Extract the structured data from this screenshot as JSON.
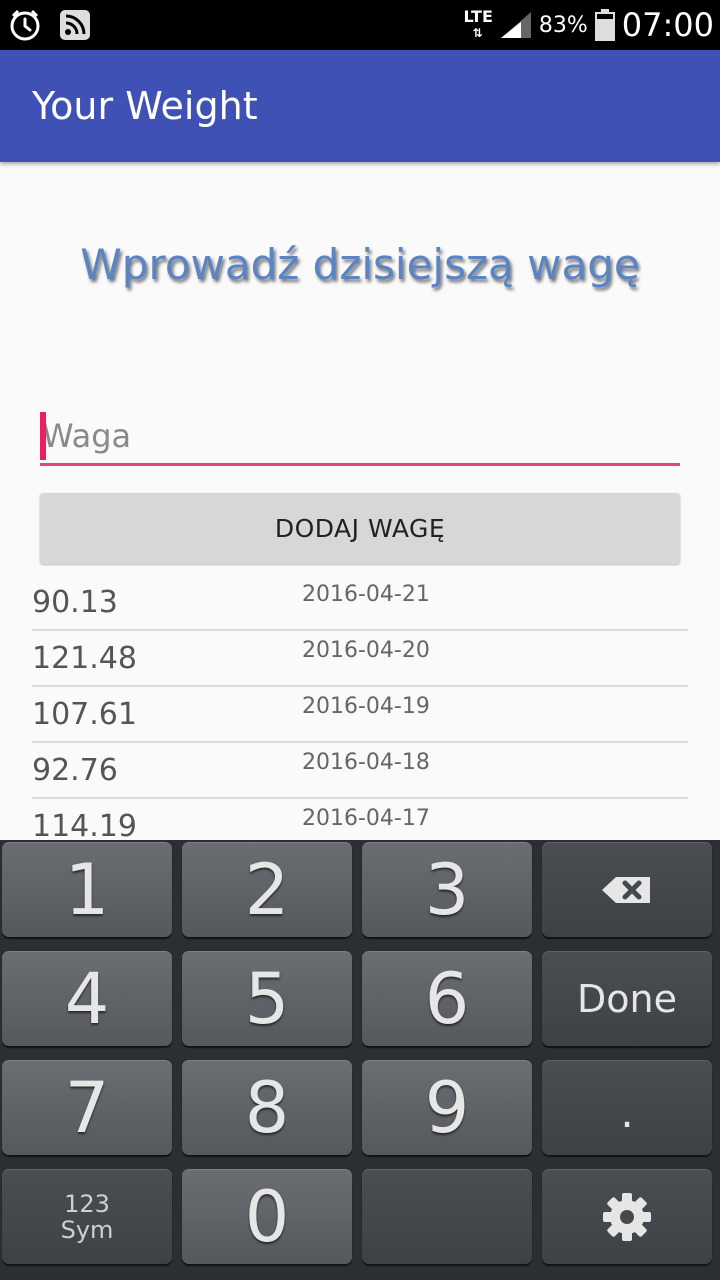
{
  "status_bar": {
    "network": "LTE",
    "battery": "83%",
    "time": "07:00",
    "icons": [
      "alarm-icon",
      "rss-icon",
      "signal-icon",
      "battery-icon"
    ]
  },
  "app_bar": {
    "title": "Your Weight"
  },
  "main": {
    "heading": "Wprowadź dzisiejszą wagę",
    "weight_input": {
      "placeholder": "Waga",
      "value": ""
    },
    "add_button_label": "DODAJ WAGĘ",
    "entries": [
      {
        "weight": "90.13",
        "date": "2016-04-21"
      },
      {
        "weight": "121.48",
        "date": "2016-04-20"
      },
      {
        "weight": "107.61",
        "date": "2016-04-19"
      },
      {
        "weight": "92.76",
        "date": "2016-04-18"
      },
      {
        "weight": "114.19",
        "date": "2016-04-17"
      }
    ]
  },
  "keyboard": {
    "keys": [
      "1",
      "2",
      "3",
      "4",
      "5",
      "6",
      "7",
      "8",
      "9",
      "0"
    ],
    "done_label": "Done",
    "dot_label": ".",
    "sym_top": "123",
    "sym_bottom": "Sym",
    "icons": [
      "backspace-icon",
      "settings-gear-icon"
    ]
  },
  "colors": {
    "app_bar": "#3f51b5",
    "accent": "#e91e63",
    "heading": "#5b84c4"
  }
}
